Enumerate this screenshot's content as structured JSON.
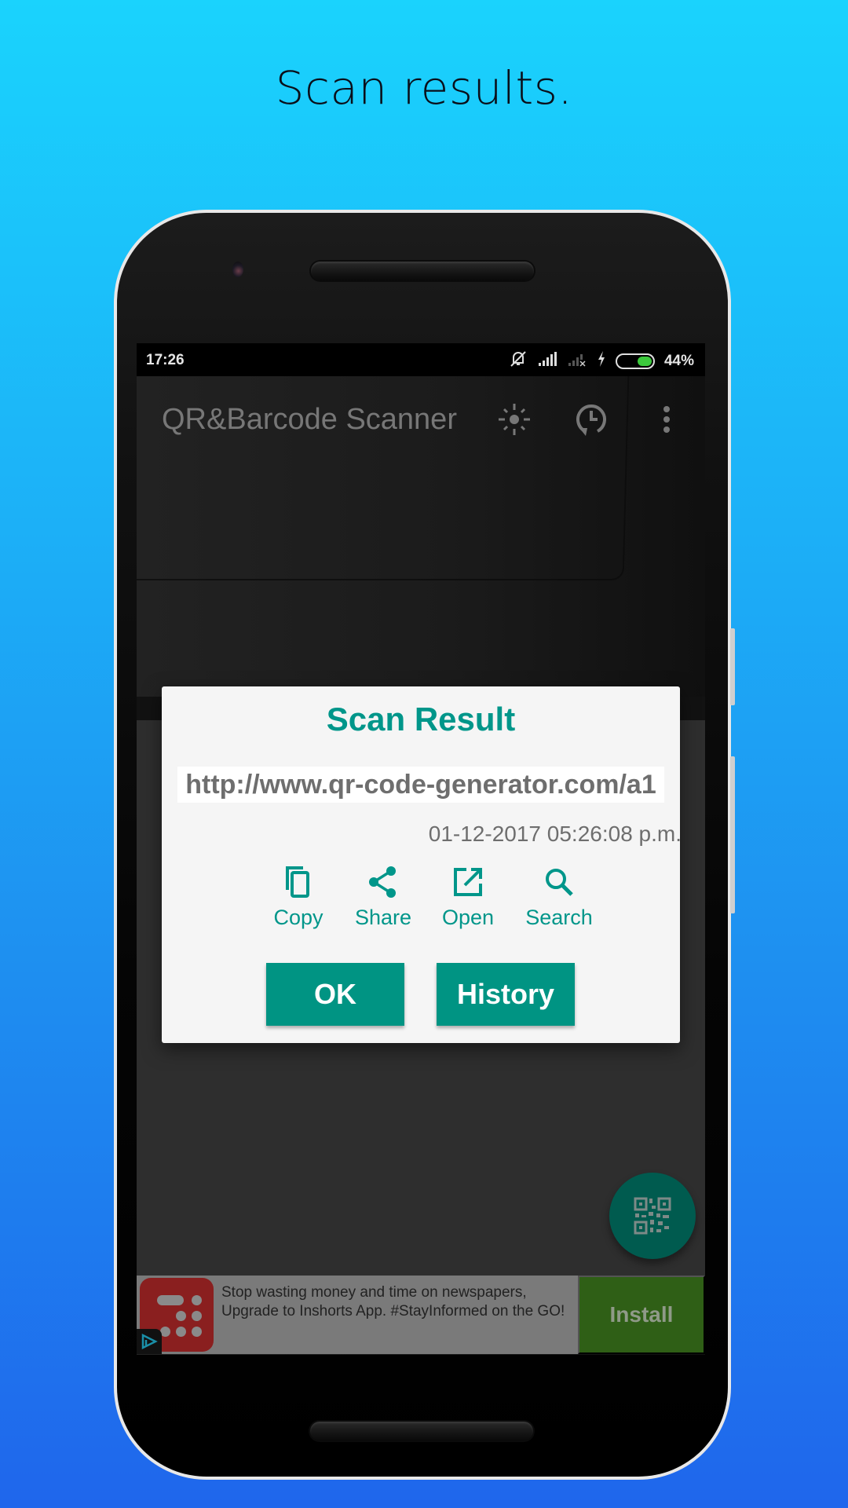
{
  "headline": "Scan results.",
  "status_bar": {
    "time": "17:26",
    "battery_percent_label": "44%",
    "battery_level": 0.44,
    "icons": [
      "vibrate-off-icon",
      "signal-icon",
      "no-signal-sim2-icon",
      "charging-icon",
      "battery-icon"
    ]
  },
  "toolbar": {
    "title": "QR&Barcode Scanner",
    "icons": [
      "flash-icon",
      "history-icon",
      "more-vert-icon"
    ]
  },
  "dialog": {
    "title": "Scan Result",
    "url": "http://www.qr-code-generator.com/a1",
    "timestamp": "01-12-2017 05:26:08 p.m.",
    "actions": [
      {
        "label": "Copy",
        "icon": "copy-icon"
      },
      {
        "label": "Share",
        "icon": "share-icon"
      },
      {
        "label": "Open",
        "icon": "open-in-new-icon"
      },
      {
        "label": "Search",
        "icon": "search-icon"
      }
    ],
    "ok_label": "OK",
    "history_label": "History"
  },
  "fab": {
    "icon": "qr-code-icon"
  },
  "ad": {
    "text": "Stop wasting money and time on newspapers, Upgrade to Inshorts App. #StayInformed on the GO!",
    "install_label": "Install"
  },
  "colors": {
    "accent": "#009688",
    "ad_install_bg": "#2f5f16",
    "battery": "#3cc93c"
  }
}
